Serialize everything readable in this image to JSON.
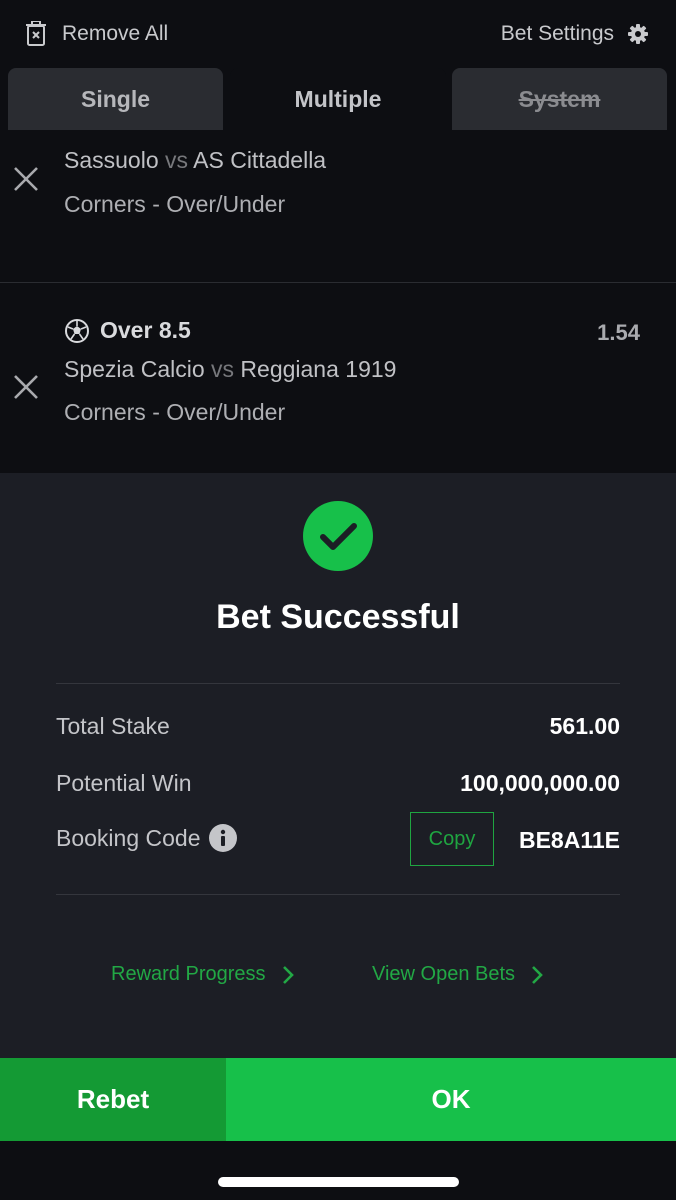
{
  "topbar": {
    "remove_all_label": "Remove All",
    "bet_settings_label": "Bet Settings"
  },
  "tabs": [
    {
      "label": "Single"
    },
    {
      "label": "Multiple",
      "active": true
    },
    {
      "label": "System",
      "disabled": true
    }
  ],
  "bets": [
    {
      "home": "Sassuolo",
      "vs": "vs",
      "away": "AS Cittadella",
      "market": "Corners - Over/Under"
    },
    {
      "selection": "Over 8.5",
      "odds": "1.54",
      "home": "Spezia Calcio",
      "vs": "vs",
      "away": "Reggiana 1919",
      "market": "Corners - Over/Under"
    }
  ],
  "result": {
    "title": "Bet Successful",
    "total_stake_label": "Total Stake",
    "total_stake_value": "561.00",
    "potential_win_label": "Potential Win",
    "potential_win_value": "100,000,000.00",
    "booking_code_label": "Booking Code",
    "copy_label": "Copy",
    "booking_code_value": "BE8A11E",
    "reward_progress_label": "Reward Progress",
    "view_open_bets_label": "View Open Bets"
  },
  "actions": {
    "rebet_label": "Rebet",
    "ok_label": "OK"
  },
  "colors": {
    "accent": "#17c04a",
    "accent_dark": "#149a34",
    "link": "#22a845",
    "sheet_bg": "#1c1e25",
    "page_bg": "#0d0e12"
  },
  "icons": [
    "trash-icon",
    "gear-icon",
    "close-icon",
    "soccer-ball-icon",
    "check-circle-icon",
    "info-icon",
    "chevron-right-icon"
  ]
}
